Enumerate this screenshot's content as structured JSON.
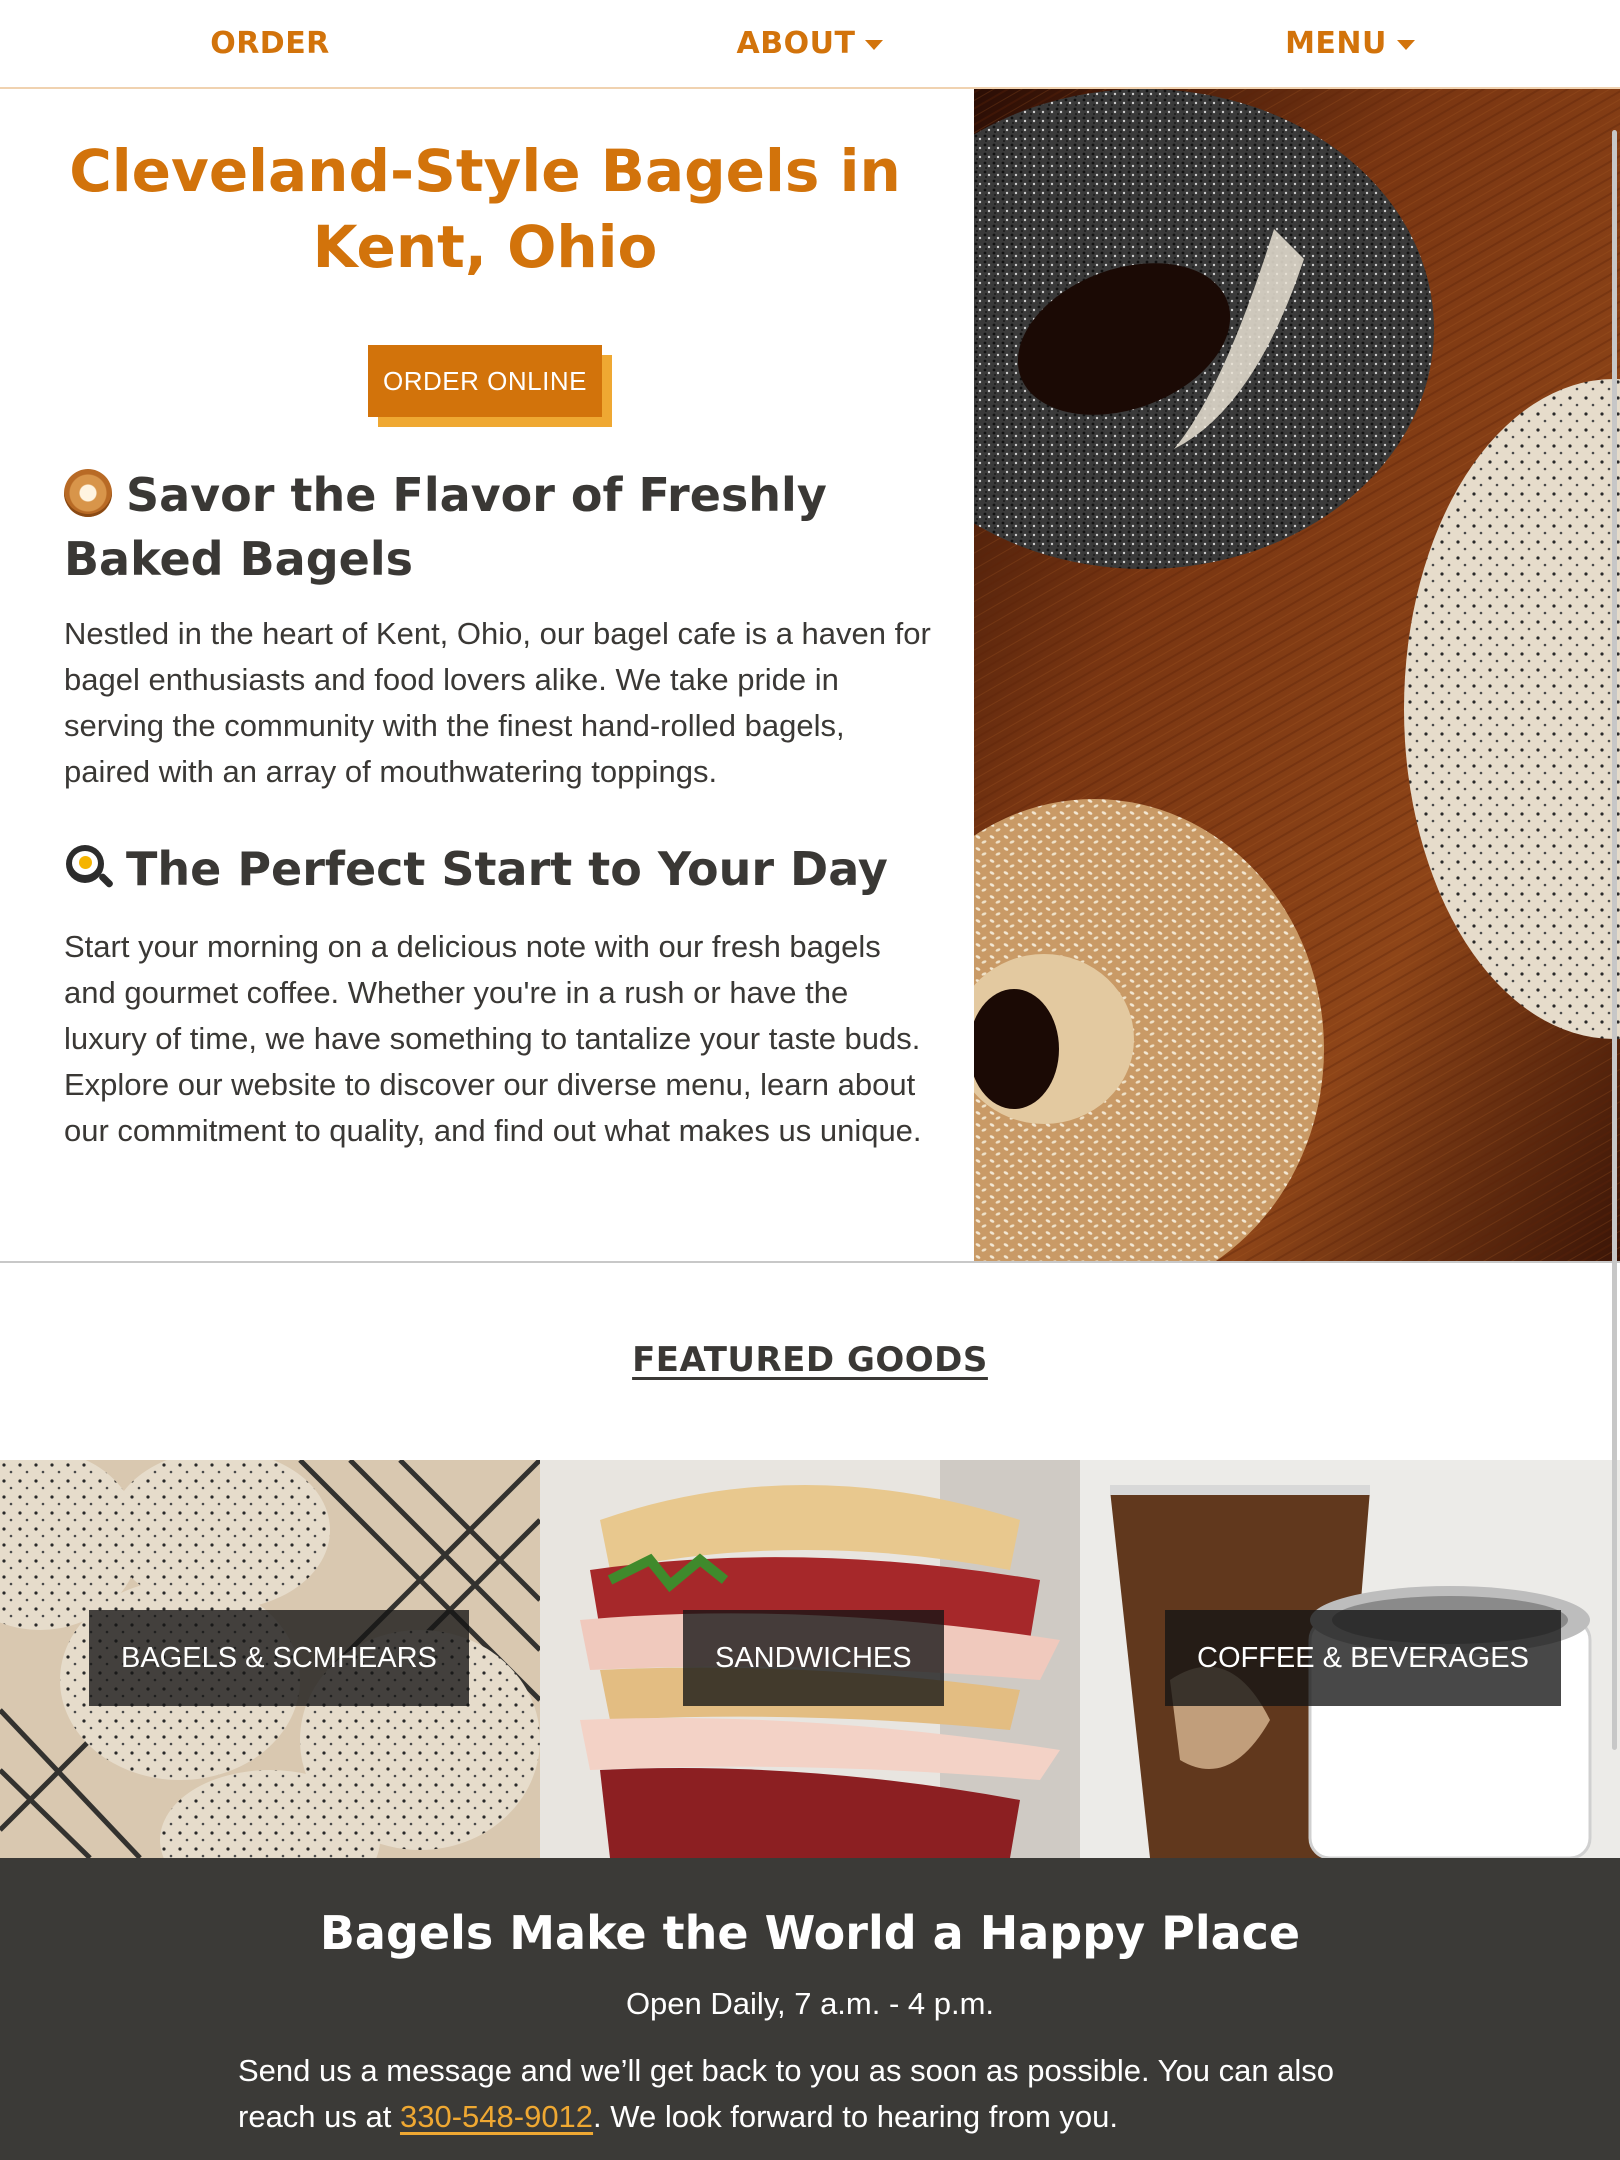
{
  "nav": {
    "order": "ORDER",
    "about": "ABOUT",
    "menu": "MENU"
  },
  "hero": {
    "title": "Cleveland-Style Bagels in Kent, Ohio",
    "order_button": "ORDER ONLINE",
    "section1": {
      "icon": "bagel-emoji",
      "heading": "Savor the Flavor of Freshly Baked Bagels",
      "body": "Nestled in the heart of Kent, Ohio, our bagel cafe is a haven for bagel enthusiasts and food lovers alike. We take pride in serving the community with the finest hand-rolled bagels, paired with an array of mouthwatering toppings."
    },
    "section2": {
      "icon": "frying-pan-emoji",
      "heading": "The Perfect Start to Your Day",
      "body": "Start your morning on a delicious note with our fresh bagels and gourmet coffee. Whether you're in a rush or have the luxury of time, we have something to tantalize your taste buds. Explore our website to discover our diverse menu, learn about our commitment to quality, and find out what makes us unique."
    }
  },
  "featured": {
    "title": "FEATURED GOODS",
    "tiles": [
      {
        "label": "BAGELS & SCMHEARS"
      },
      {
        "label": "SANDWICHES"
      },
      {
        "label": "COFFEE & BEVERAGES"
      }
    ]
  },
  "footer": {
    "title": "Bagels Make the World a Happy Place",
    "hours": "Open Daily, 7 a.m. - 4 p.m.",
    "message_before": "Send us a message and we’ll get back to you as soon as possible. You can also reach us at ",
    "phone": "330-548-9012",
    "message_after": ". We look forward to hearing from you."
  },
  "colors": {
    "accent": "#d2730b",
    "accent_light": "#efa832",
    "text": "#3a3835",
    "footer_bg": "#3b3a37"
  }
}
